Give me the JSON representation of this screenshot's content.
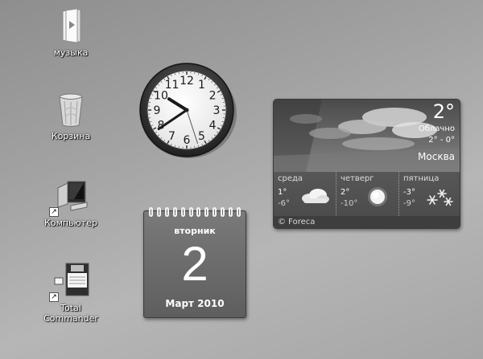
{
  "desktop": {
    "icons": [
      {
        "label": "музыка",
        "icon": "music-folder-icon"
      },
      {
        "label": "Корзина",
        "icon": "recycle-bin-icon"
      },
      {
        "label": "Компьютер",
        "icon": "computer-icon"
      },
      {
        "label": "Total Commander",
        "icon": "floppy-disk-icon"
      }
    ]
  },
  "clock": {
    "numerals": [
      "12",
      "1",
      "2",
      "3",
      "4",
      "5",
      "6",
      "7",
      "8",
      "9",
      "10",
      "11"
    ],
    "hour_angle_deg": 302,
    "minute_angle_deg": 236,
    "second_angle_deg": 162
  },
  "calendar": {
    "weekday": "вторник",
    "day": "2",
    "month_year": "Март 2010"
  },
  "weather": {
    "current_temp": "2°",
    "condition": "Облачно",
    "range": "2° - 0°",
    "city": "Москва",
    "forecast": [
      {
        "day": "среда",
        "high": "1°",
        "low": "-6°",
        "icon": "cloudy-icon"
      },
      {
        "day": "четверг",
        "high": "2°",
        "low": "-10°",
        "icon": "sun-icon"
      },
      {
        "day": "пятница",
        "high": "-3°",
        "low": "-9°",
        "icon": "snow-icon"
      }
    ],
    "provider": "© Foreca"
  }
}
